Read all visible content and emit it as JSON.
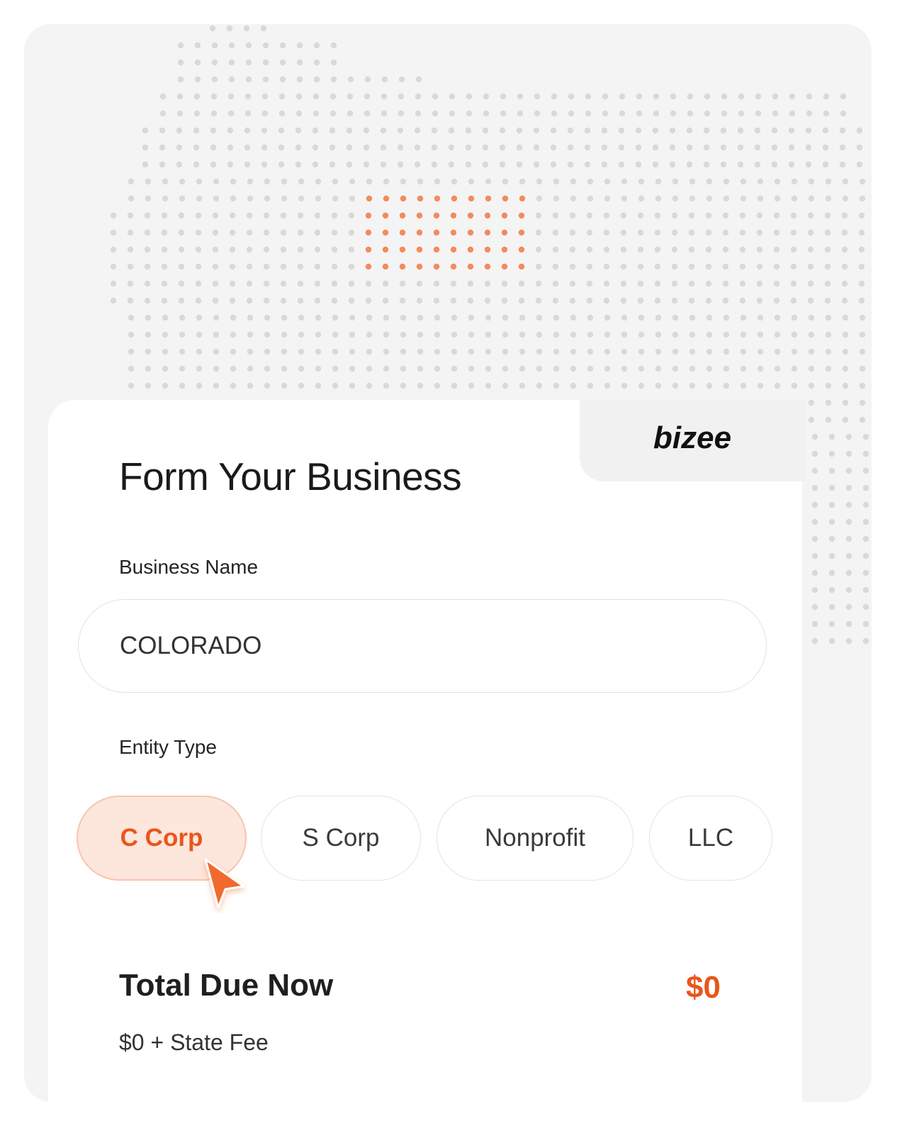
{
  "brand": {
    "logo_text": "bizee",
    "accent_color": "#e8561b"
  },
  "map": {
    "highlighted_state": "Colorado",
    "dot_color": "#d9d9d9",
    "highlight_color": "#f58a5c"
  },
  "form": {
    "title": "Form Your Business",
    "business_name": {
      "label": "Business Name",
      "value": "COLORADO"
    },
    "entity_type": {
      "label": "Entity Type",
      "options": [
        "C Corp",
        "S Corp",
        "Nonprofit",
        "LLC"
      ],
      "selected": "C Corp"
    },
    "total": {
      "label": "Total Due Now",
      "value": "$0",
      "breakdown": "$0 + State Fee"
    }
  }
}
